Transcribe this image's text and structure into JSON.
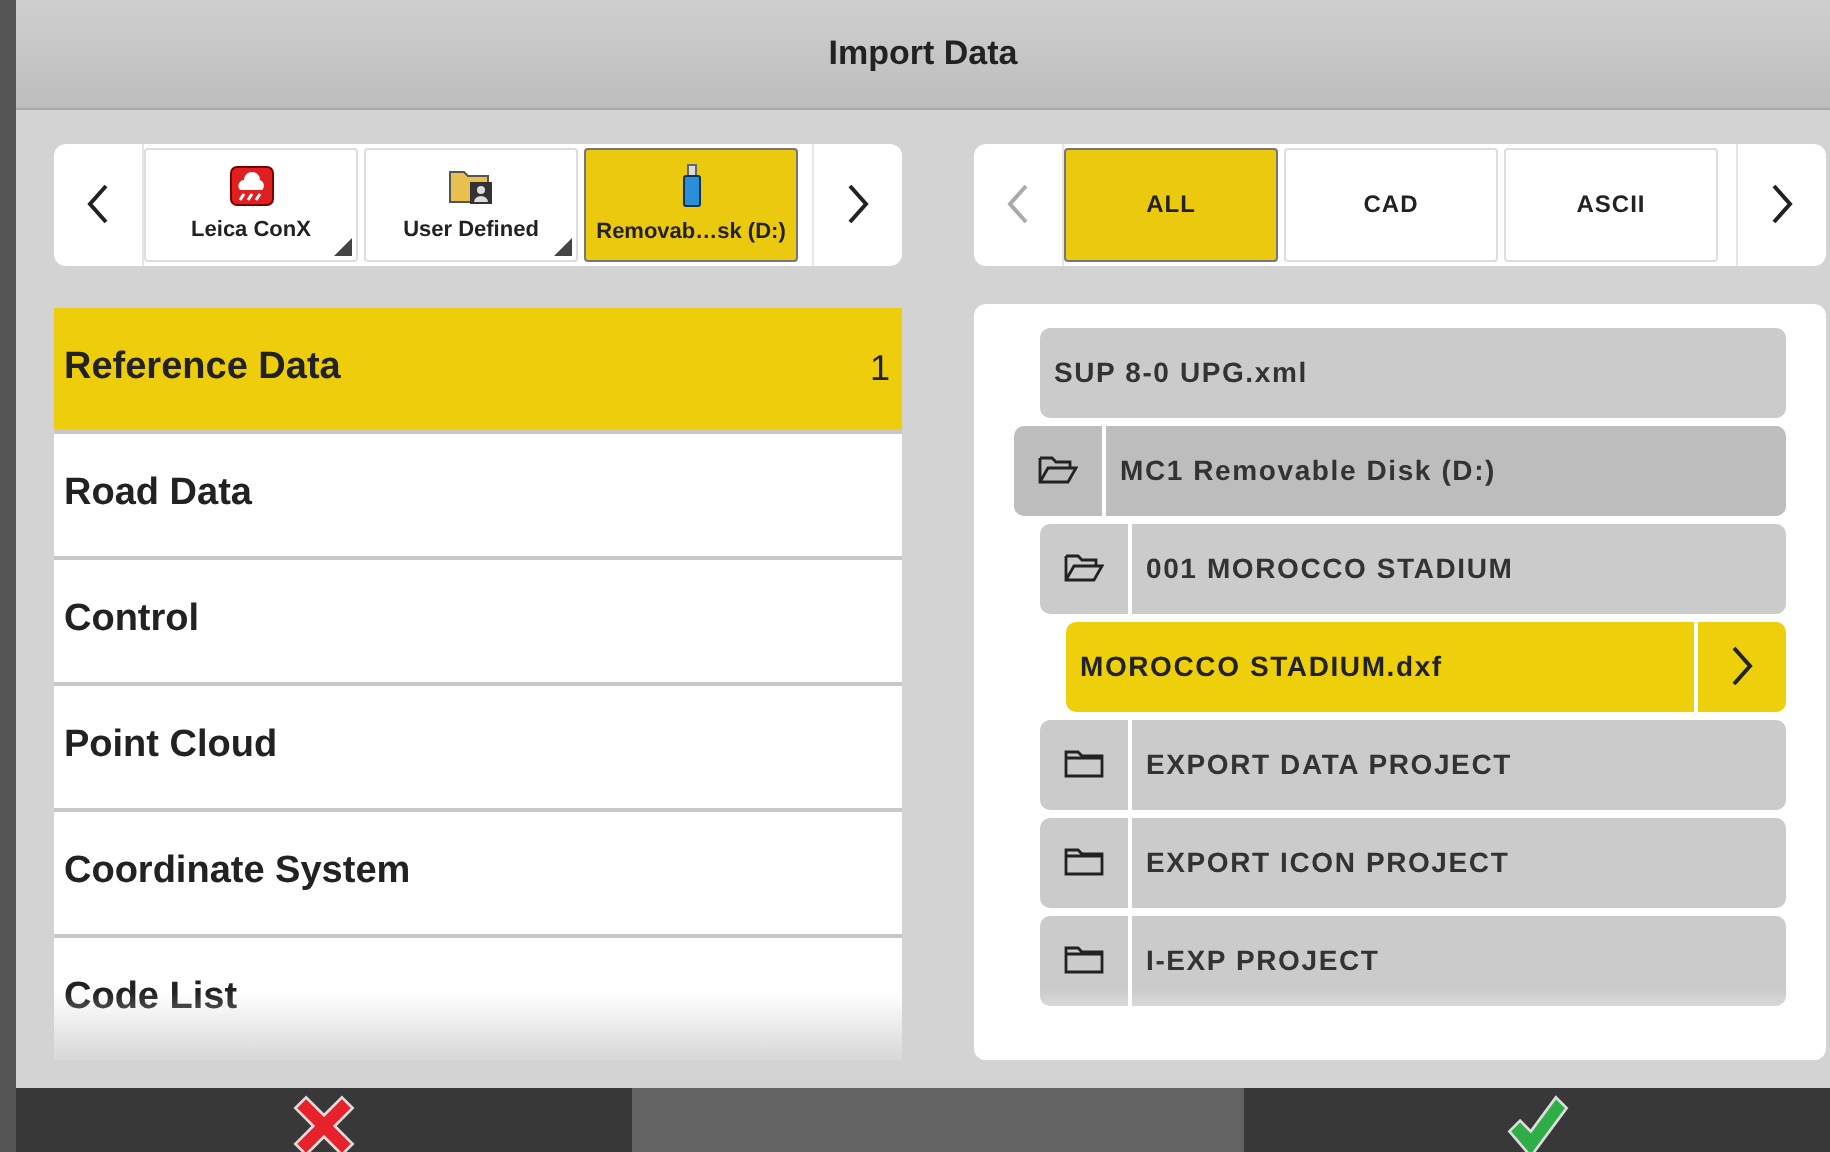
{
  "window": {
    "title": "Import Data"
  },
  "sources": [
    {
      "label": "Leica ConX",
      "kind": "cloud",
      "has_menu": true,
      "selected": false
    },
    {
      "label": "User Defined",
      "kind": "folder-user",
      "has_menu": true,
      "selected": false
    },
    {
      "label": "Removab…sk (D:)",
      "kind": "usb",
      "has_menu": false,
      "selected": true
    }
  ],
  "source_scroll": {
    "prev_disabled": false,
    "next_disabled": false
  },
  "file_types": [
    {
      "label": "ALL",
      "selected": true
    },
    {
      "label": "CAD",
      "selected": false
    },
    {
      "label": "ASCII",
      "selected": false
    }
  ],
  "type_scroll": {
    "prev_disabled": true,
    "next_disabled": false
  },
  "categories": [
    {
      "label": "Reference Data",
      "count": "1",
      "selected": true
    },
    {
      "label": "Road Data",
      "selected": false
    },
    {
      "label": "Control",
      "selected": false
    },
    {
      "label": "Point Cloud",
      "selected": false
    },
    {
      "label": "Coordinate System",
      "selected": false
    },
    {
      "label": "Code List",
      "selected": false
    }
  ],
  "tree": [
    {
      "kind": "file",
      "name": "SUP 8-0 UPG.xml",
      "selected": false
    },
    {
      "kind": "folder",
      "name": "MC1 Removable Disk (D:)",
      "expanded": true,
      "children": [
        {
          "kind": "folder",
          "name": "001 MOROCCO STADIUM",
          "expanded": true,
          "children": [
            {
              "kind": "file",
              "name": "MOROCCO STADIUM.dxf",
              "selected": true
            }
          ]
        },
        {
          "kind": "folder",
          "name": "EXPORT DATA PROJECT",
          "expanded": false
        },
        {
          "kind": "folder",
          "name": "EXPORT ICON PROJECT",
          "expanded": false
        },
        {
          "kind": "folder",
          "name": "I-EXP PROJECT",
          "expanded": false
        }
      ]
    }
  ],
  "footer": {
    "buttons": [
      {
        "kind": "cancel"
      },
      {
        "kind": "blank"
      },
      {
        "kind": "ok"
      }
    ]
  }
}
